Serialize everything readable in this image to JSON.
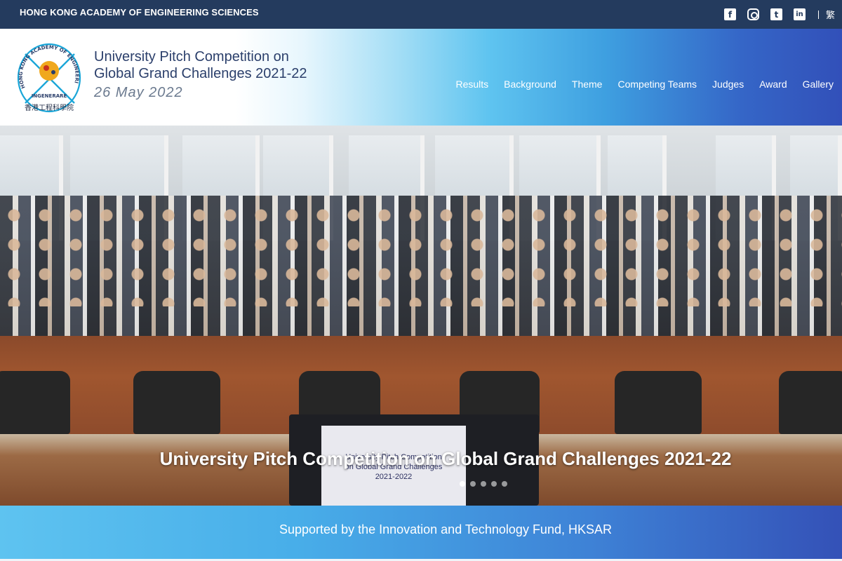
{
  "topbar": {
    "org_name": "HONG KONG ACADEMY OF ENGINEERING SCIENCES",
    "social": [
      {
        "name": "facebook-icon",
        "glyph": "f"
      },
      {
        "name": "instagram-icon",
        "glyph": ""
      },
      {
        "name": "twitter-icon",
        "glyph": "t"
      },
      {
        "name": "linkedin-icon",
        "glyph": "in"
      }
    ],
    "language_toggle": "繁"
  },
  "header": {
    "logo": {
      "ring_text": "HONG KONG ACADEMY OF ENGINEERING SCIENCES",
      "motto": "INGENERARE",
      "chinese_name": "香港工程科學院"
    },
    "title_line1": "University Pitch Competition on",
    "title_line2": "Global Grand Challenges 2021-22",
    "date": "26 May 2022",
    "nav": [
      "Results",
      "Background",
      "Theme",
      "Competing Teams",
      "Judges",
      "Award",
      "Gallery"
    ]
  },
  "hero": {
    "caption": "University Pitch Competition on Global Grand Challenges 2021-22",
    "screen_text": [
      "University Pitch Competition",
      "on Global Grand Challenges",
      "2021-2022"
    ],
    "slide_count": 5,
    "active_slide": 1
  },
  "support": {
    "text": "Supported by the Innovation and Technology Fund, HKSAR"
  },
  "colors": {
    "topbar": "#243b5e",
    "title": "#2b3f6b",
    "date": "#6b7a8f",
    "accent_blue": "#3250b9",
    "light_blue": "#5ec3f0"
  }
}
